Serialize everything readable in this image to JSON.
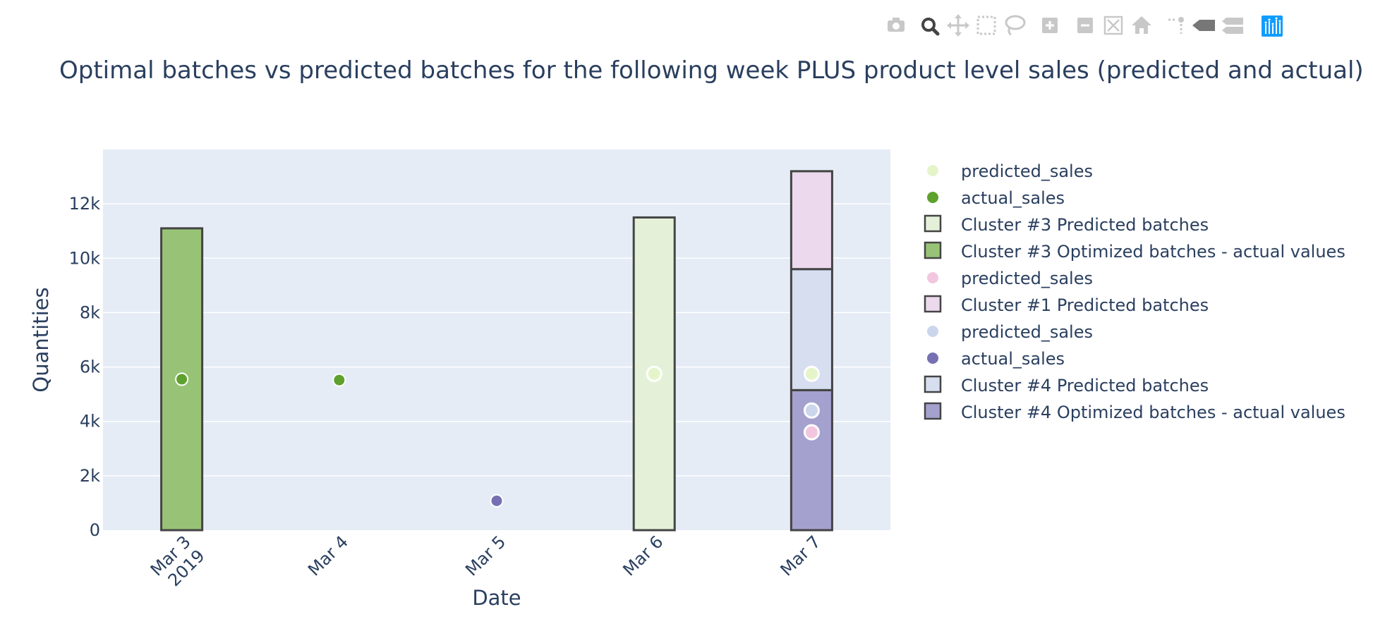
{
  "modebar": {
    "buttons": [
      "camera-icon",
      "zoom-icon",
      "pan-icon",
      "box-select-icon",
      "lasso-select-icon",
      "zoom-in-icon",
      "zoom-out-icon",
      "autoscale-icon",
      "reset-axes-icon",
      "spike-lines-icon",
      "hover-closest-icon",
      "hover-compare-icon",
      "plotly-logo-icon"
    ]
  },
  "colors": {
    "plot_bg": "#e5ecf6",
    "grid": "#ffffff",
    "text": "#2a3f5f",
    "active_icon": "#444444",
    "inactive_icon": "#c8c8c8",
    "plotly_blue": "#119dff"
  },
  "chart_data": {
    "type": "bar",
    "title": "Optimal batches vs predicted batches for the following week  PLUS product level sales (predicted and actual)",
    "xlabel": "Date",
    "ylabel": "Quantities",
    "categories": [
      "Mar 3\n2019",
      "Mar 4",
      "Mar 5",
      "Mar 6",
      "Mar 7"
    ],
    "ylim": [
      0,
      14000
    ],
    "yticks": [
      0,
      2000,
      4000,
      6000,
      8000,
      10000,
      12000
    ],
    "ytick_labels": [
      "0",
      "2k",
      "4k",
      "6k",
      "8k",
      "10k",
      "12k"
    ],
    "barmode": "stack",
    "grid": true,
    "legend_position": "right",
    "series": [
      {
        "name": "predicted_sales",
        "kind": "marker",
        "color": "#e5f5c9",
        "points": [
          {
            "x": 3,
            "y": 5750
          },
          {
            "x": 4,
            "y": 5750
          }
        ]
      },
      {
        "name": "actual_sales",
        "kind": "marker",
        "color": "#5ea12e",
        "points": [
          {
            "x": 0,
            "y": 5550
          },
          {
            "x": 1,
            "y": 5520
          }
        ]
      },
      {
        "name": "Cluster #3 Predicted batches",
        "kind": "bar",
        "color": "#e4f1d8",
        "values": [
          null,
          null,
          null,
          11500,
          null
        ]
      },
      {
        "name": "Cluster #3 Optimized batches - actual values",
        "kind": "bar",
        "color": "#98c377",
        "values": [
          11100,
          null,
          null,
          null,
          null
        ]
      },
      {
        "name": "predicted_sales",
        "kind": "marker",
        "color": "#f3c6e0",
        "points": [
          {
            "x": 4,
            "y": 3600
          }
        ]
      },
      {
        "name": "Cluster #1 Predicted batches",
        "kind": "bar",
        "color": "#ecd9ed",
        "values": [
          null,
          null,
          null,
          null,
          3600
        ]
      },
      {
        "name": "predicted_sales",
        "kind": "marker",
        "color": "#cbd6ec",
        "points": [
          {
            "x": 4,
            "y": 4400
          }
        ]
      },
      {
        "name": "actual_sales",
        "kind": "marker",
        "color": "#7670b3",
        "points": [
          {
            "x": 2,
            "y": 1080
          }
        ]
      },
      {
        "name": "Cluster #4 Predicted batches",
        "kind": "bar",
        "color": "#d6def0",
        "values": [
          null,
          null,
          null,
          null,
          4450
        ]
      },
      {
        "name": "Cluster #4 Optimized batches - actual values",
        "kind": "bar",
        "color": "#a4a1cf",
        "values": [
          null,
          null,
          null,
          null,
          5150
        ]
      }
    ],
    "bar_stack_order": [
      "Cluster #4 Optimized batches - actual values",
      "Cluster #4 Predicted batches",
      "Cluster #1 Predicted batches",
      "Cluster #3 Optimized batches - actual values",
      "Cluster #3 Predicted batches"
    ]
  }
}
